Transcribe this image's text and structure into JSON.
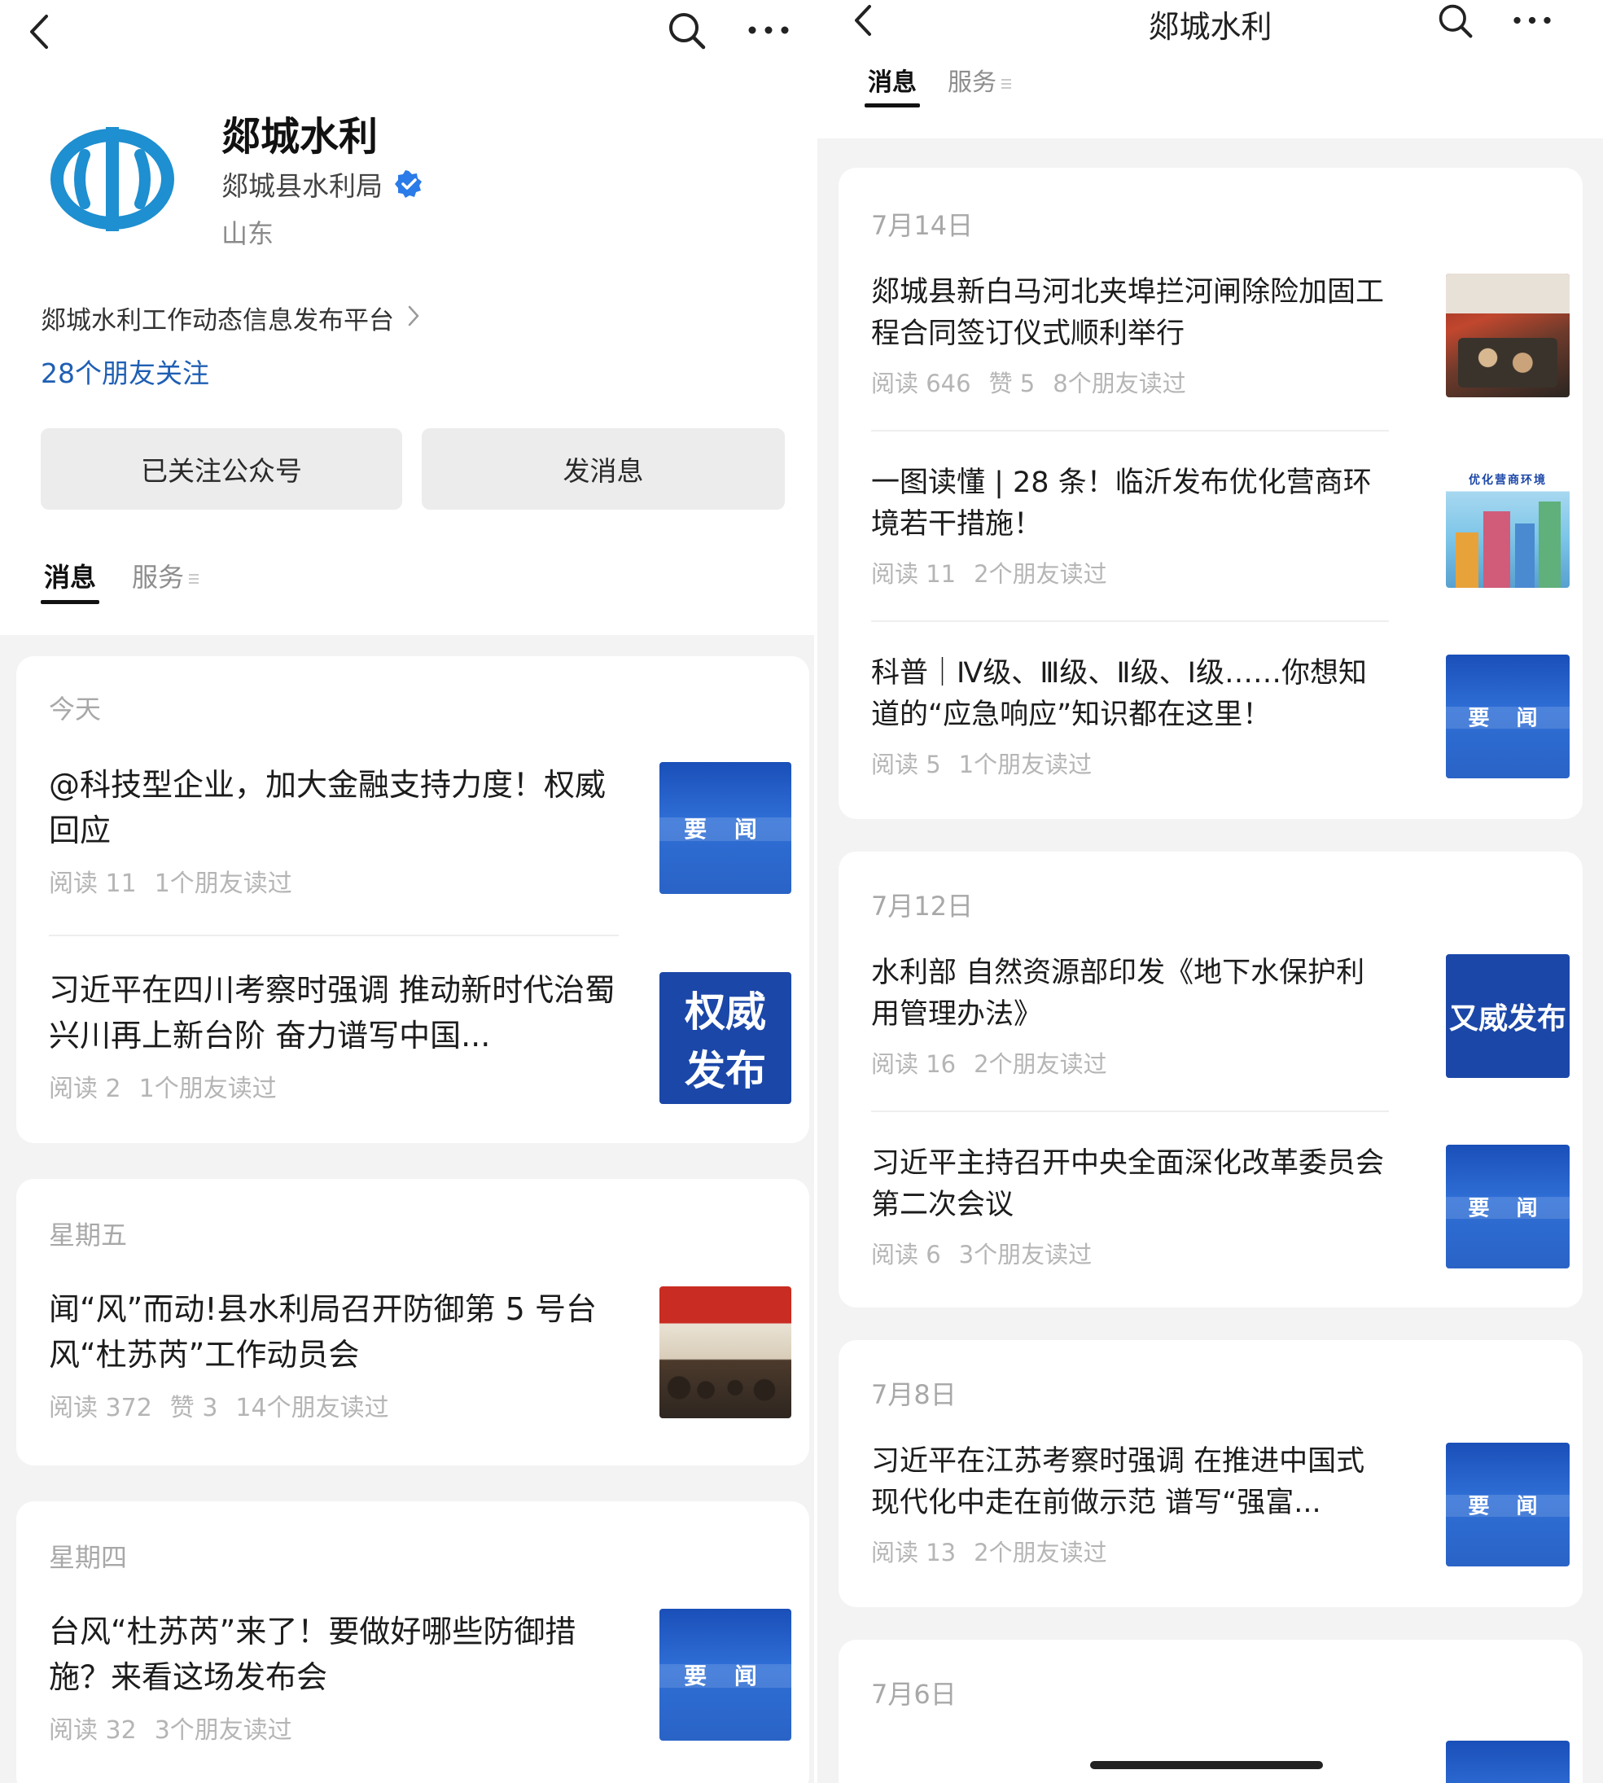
{
  "left": {
    "account_name": "郯城水利",
    "org_name": "郯城县水利局",
    "region": "山东",
    "description": "郯城水利工作动态信息发布平台",
    "friends_follow": "28个朋友关注",
    "buttons": {
      "followed": "已关注公众号",
      "message": "发消息"
    },
    "tabs": [
      {
        "label": "消息"
      },
      {
        "label": "服务"
      }
    ],
    "groups": [
      {
        "date": "今天",
        "articles": [
          {
            "title": "@科技型企业，加大金融支持力度！权威回应",
            "reads": "阅读 11",
            "likes": "",
            "friends": "1个朋友读过",
            "thumb_label": "要 闻"
          },
          {
            "title": "习近平在四川考察时强调 推动新时代治蜀兴川再上新台阶 奋力谱写中国...",
            "reads": "阅读 2",
            "likes": "",
            "friends": "1个朋友读过",
            "thumb_line1": "权威",
            "thumb_line2": "发布"
          }
        ]
      },
      {
        "date": "星期五",
        "articles": [
          {
            "title": "闻“风”而动!县水利局召开防御第 5 号台风“杜苏芮”工作动员会",
            "reads": "阅读 372",
            "likes": "赞 3",
            "friends": "14个朋友读过"
          }
        ]
      },
      {
        "date": "星期四",
        "articles": [
          {
            "title": "台风“杜苏芮”来了！要做好哪些防御措施？来看这场发布会",
            "reads": "阅读 32",
            "likes": "",
            "friends": "3个朋友读过",
            "thumb_label": "要 闻"
          }
        ]
      }
    ]
  },
  "right": {
    "title": "郯城水利",
    "tabs": [
      {
        "label": "消息"
      },
      {
        "label": "服务"
      }
    ],
    "groups": [
      {
        "date": "7月14日",
        "articles": [
          {
            "title": "郯城县新白马河北夹埠拦河闸除险加固工程合同签订仪式顺利举行",
            "reads": "阅读 646",
            "likes": "赞 5",
            "friends": "8个朋友读过"
          },
          {
            "title": "一图读懂 | 28 条！临沂发布优化营商环境若干措施！",
            "reads": "阅读 11",
            "likes": "",
            "friends": "2个朋友读过",
            "thumb_caption": "优化营商环境"
          },
          {
            "title": "科普｜Ⅳ级、Ⅲ级、Ⅱ级、Ⅰ级……你想知道的“应急响应”知识都在这里！",
            "reads": "阅读 5",
            "likes": "",
            "friends": "1个朋友读过",
            "thumb_label": "要 闻"
          }
        ]
      },
      {
        "date": "7月12日",
        "articles": [
          {
            "title": "水利部 自然资源部印发《地下水保护利用管理办法》",
            "reads": "阅读 16",
            "likes": "",
            "friends": "2个朋友读过",
            "thumb_label": "又威发布"
          },
          {
            "title": "习近平主持召开中央全面深化改革委员会第二次会议",
            "reads": "阅读 6",
            "likes": "",
            "friends": "3个朋友读过",
            "thumb_label": "要 闻"
          }
        ]
      },
      {
        "date": "7月8日",
        "articles": [
          {
            "title": "习近平在江苏考察时强调 在推进中国式现代化中走在前做示范 谱写“强富...",
            "reads": "阅读 13",
            "likes": "",
            "friends": "2个朋友读过",
            "thumb_label": "要 闻"
          }
        ]
      },
      {
        "date": "7月6日",
        "articles": []
      }
    ]
  },
  "icons": {
    "back": "chevron-left-icon",
    "search": "search-icon",
    "more": "more-dots-icon",
    "verified": "verified-badge-icon",
    "logo": "water-conservancy-logo"
  },
  "colors": {
    "link_blue": "#1f5fb4",
    "logo_blue": "#1e8fd0",
    "thumb_blue": "#1b47a8",
    "background": "#f3f3f3"
  }
}
